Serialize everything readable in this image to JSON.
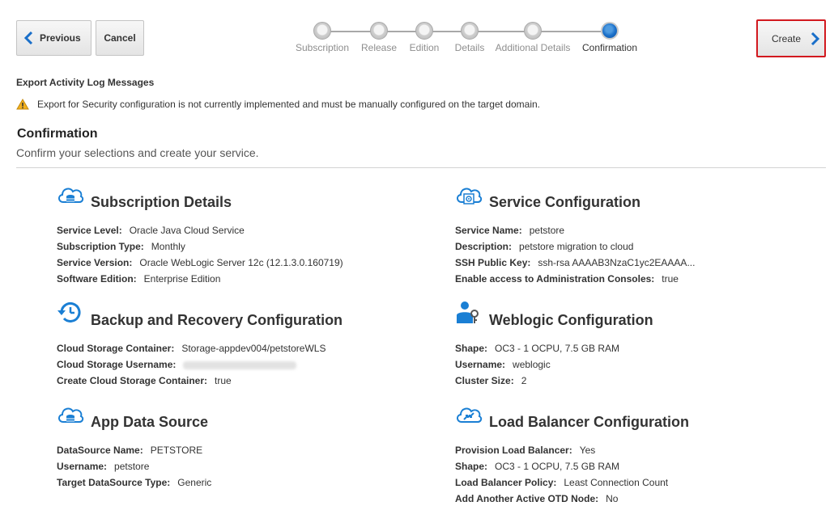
{
  "nav": {
    "previous_label": "Previous",
    "cancel_label": "Cancel",
    "create_label": "Create"
  },
  "train": {
    "steps": [
      {
        "label": "Subscription",
        "state": "complete"
      },
      {
        "label": "Release",
        "state": "complete"
      },
      {
        "label": "Edition",
        "state": "complete"
      },
      {
        "label": "Details",
        "state": "complete"
      },
      {
        "label": "Additional Details",
        "state": "complete"
      },
      {
        "label": "Confirmation",
        "state": "current"
      }
    ]
  },
  "export_log": {
    "title": "Export Activity Log Messages",
    "warning": "Export for Security configuration is not currently implemented and must be manually configured on the target domain."
  },
  "confirmation": {
    "title": "Confirmation",
    "subtitle": "Confirm your selections and create your service."
  },
  "sections": {
    "subscription": {
      "title": "Subscription Details",
      "rows": [
        {
          "key": "Service Level:",
          "value": "Oracle Java Cloud Service"
        },
        {
          "key": "Subscription Type:",
          "value": "Monthly"
        },
        {
          "key": "Service Version:",
          "value": "Oracle WebLogic Server 12c (12.1.3.0.160719)"
        },
        {
          "key": "Software Edition:",
          "value": "Enterprise Edition"
        }
      ]
    },
    "service": {
      "title": "Service Configuration",
      "rows": [
        {
          "key": "Service Name:",
          "value": "petstore"
        },
        {
          "key": "Description:",
          "value": "petstore migration to cloud"
        },
        {
          "key": "SSH Public Key:",
          "value": "ssh-rsa AAAAB3NzaC1yc2EAAAA..."
        },
        {
          "key": "Enable access to Administration Consoles:",
          "value": "true"
        }
      ]
    },
    "backup": {
      "title": "Backup and Recovery Configuration",
      "rows": [
        {
          "key": "Cloud Storage Container:",
          "value": "Storage-appdev004/petstoreWLS"
        },
        {
          "key": "Cloud Storage Username:",
          "value": ""
        },
        {
          "key": "Create Cloud Storage Container:",
          "value": "true"
        }
      ]
    },
    "weblogic": {
      "title": "Weblogic Configuration",
      "rows": [
        {
          "key": "Shape:",
          "value": "OC3 - 1 OCPU, 7.5 GB RAM"
        },
        {
          "key": "Username:",
          "value": "weblogic"
        },
        {
          "key": "Cluster Size:",
          "value": "2"
        }
      ]
    },
    "datasource": {
      "title": "App Data Source",
      "rows": [
        {
          "key": "DataSource Name:",
          "value": "PETSTORE"
        },
        {
          "key": "Username:",
          "value": "petstore"
        },
        {
          "key": "Target DataSource Type:",
          "value": "Generic"
        }
      ]
    },
    "loadbalancer": {
      "title": "Load Balancer Configuration",
      "rows": [
        {
          "key": "Provision Load Balancer:",
          "value": "Yes"
        },
        {
          "key": "Shape:",
          "value": "OC3 - 1 OCPU, 7.5 GB RAM"
        },
        {
          "key": "Load Balancer Policy:",
          "value": "Least Connection Count"
        },
        {
          "key": "Add Another Active OTD Node:",
          "value": "No"
        }
      ]
    }
  },
  "colors": {
    "accent": "#1a6fc9",
    "highlight_border": "#d2191f",
    "warning": "#f2b01e"
  }
}
